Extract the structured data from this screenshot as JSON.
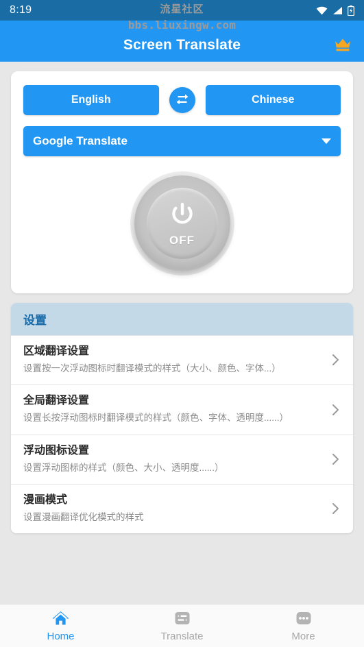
{
  "statusbar": {
    "time": "8:19",
    "icons": [
      "wifi-icon",
      "signal-icon",
      "battery-icon"
    ]
  },
  "watermark": {
    "line1": "流星社区",
    "line2": "bbs.liuxingw.com"
  },
  "appbar": {
    "title": "Screen Translate",
    "premium_icon": "crown-icon",
    "background": "#2196f3"
  },
  "translate_card": {
    "source_language": "English",
    "target_language": "Chinese",
    "swap_icon": "swap-arrows-icon",
    "engine": "Google Translate",
    "engine_caret_icon": "caret-down-icon",
    "power": {
      "state_label": "OFF",
      "icon": "power-icon"
    }
  },
  "settings": {
    "header": "设置",
    "header_bg": "#c3d9e8",
    "header_color": "#1a6ba8",
    "rows": [
      {
        "title": "区域翻译设置",
        "subtitle": "设置按一次浮动图标时翻译模式的样式（大小、颜色、字体...）",
        "chevron_icon": "chevron-right-icon"
      },
      {
        "title": "全局翻译设置",
        "subtitle": "设置长按浮动图标时翻译模式的样式（颜色、字体、透明度......）",
        "chevron_icon": "chevron-right-icon"
      },
      {
        "title": "浮动图标设置",
        "subtitle": "设置浮动图标的样式（颜色、大小、透明度......）",
        "chevron_icon": "chevron-right-icon"
      },
      {
        "title": "漫画模式",
        "subtitle": "设置漫画翻译优化模式的样式",
        "chevron_icon": "chevron-right-icon"
      }
    ]
  },
  "bottomnav": {
    "active_color": "#2196f3",
    "inactive_color": "#a8a8a8",
    "items": [
      {
        "label": "Home",
        "icon": "home-icon",
        "active": true
      },
      {
        "label": "Translate",
        "icon": "translate-list-icon",
        "active": false
      },
      {
        "label": "More",
        "icon": "more-dots-icon",
        "active": false
      }
    ]
  }
}
